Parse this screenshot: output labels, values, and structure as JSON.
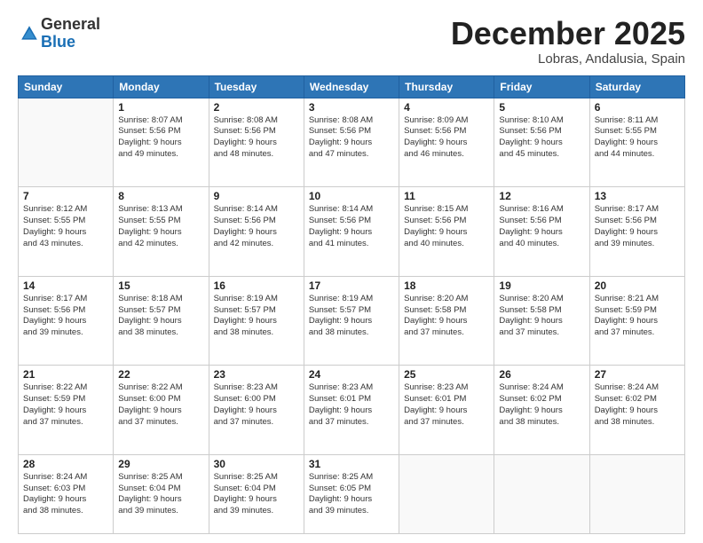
{
  "logo": {
    "general": "General",
    "blue": "Blue"
  },
  "header": {
    "month": "December 2025",
    "location": "Lobras, Andalusia, Spain"
  },
  "weekdays": [
    "Sunday",
    "Monday",
    "Tuesday",
    "Wednesday",
    "Thursday",
    "Friday",
    "Saturday"
  ],
  "weeks": [
    [
      {
        "day": "",
        "lines": []
      },
      {
        "day": "1",
        "lines": [
          "Sunrise: 8:07 AM",
          "Sunset: 5:56 PM",
          "Daylight: 9 hours",
          "and 49 minutes."
        ]
      },
      {
        "day": "2",
        "lines": [
          "Sunrise: 8:08 AM",
          "Sunset: 5:56 PM",
          "Daylight: 9 hours",
          "and 48 minutes."
        ]
      },
      {
        "day": "3",
        "lines": [
          "Sunrise: 8:08 AM",
          "Sunset: 5:56 PM",
          "Daylight: 9 hours",
          "and 47 minutes."
        ]
      },
      {
        "day": "4",
        "lines": [
          "Sunrise: 8:09 AM",
          "Sunset: 5:56 PM",
          "Daylight: 9 hours",
          "and 46 minutes."
        ]
      },
      {
        "day": "5",
        "lines": [
          "Sunrise: 8:10 AM",
          "Sunset: 5:56 PM",
          "Daylight: 9 hours",
          "and 45 minutes."
        ]
      },
      {
        "day": "6",
        "lines": [
          "Sunrise: 8:11 AM",
          "Sunset: 5:55 PM",
          "Daylight: 9 hours",
          "and 44 minutes."
        ]
      }
    ],
    [
      {
        "day": "7",
        "lines": [
          "Sunrise: 8:12 AM",
          "Sunset: 5:55 PM",
          "Daylight: 9 hours",
          "and 43 minutes."
        ]
      },
      {
        "day": "8",
        "lines": [
          "Sunrise: 8:13 AM",
          "Sunset: 5:55 PM",
          "Daylight: 9 hours",
          "and 42 minutes."
        ]
      },
      {
        "day": "9",
        "lines": [
          "Sunrise: 8:14 AM",
          "Sunset: 5:56 PM",
          "Daylight: 9 hours",
          "and 42 minutes."
        ]
      },
      {
        "day": "10",
        "lines": [
          "Sunrise: 8:14 AM",
          "Sunset: 5:56 PM",
          "Daylight: 9 hours",
          "and 41 minutes."
        ]
      },
      {
        "day": "11",
        "lines": [
          "Sunrise: 8:15 AM",
          "Sunset: 5:56 PM",
          "Daylight: 9 hours",
          "and 40 minutes."
        ]
      },
      {
        "day": "12",
        "lines": [
          "Sunrise: 8:16 AM",
          "Sunset: 5:56 PM",
          "Daylight: 9 hours",
          "and 40 minutes."
        ]
      },
      {
        "day": "13",
        "lines": [
          "Sunrise: 8:17 AM",
          "Sunset: 5:56 PM",
          "Daylight: 9 hours",
          "and 39 minutes."
        ]
      }
    ],
    [
      {
        "day": "14",
        "lines": [
          "Sunrise: 8:17 AM",
          "Sunset: 5:56 PM",
          "Daylight: 9 hours",
          "and 39 minutes."
        ]
      },
      {
        "day": "15",
        "lines": [
          "Sunrise: 8:18 AM",
          "Sunset: 5:57 PM",
          "Daylight: 9 hours",
          "and 38 minutes."
        ]
      },
      {
        "day": "16",
        "lines": [
          "Sunrise: 8:19 AM",
          "Sunset: 5:57 PM",
          "Daylight: 9 hours",
          "and 38 minutes."
        ]
      },
      {
        "day": "17",
        "lines": [
          "Sunrise: 8:19 AM",
          "Sunset: 5:57 PM",
          "Daylight: 9 hours",
          "and 38 minutes."
        ]
      },
      {
        "day": "18",
        "lines": [
          "Sunrise: 8:20 AM",
          "Sunset: 5:58 PM",
          "Daylight: 9 hours",
          "and 37 minutes."
        ]
      },
      {
        "day": "19",
        "lines": [
          "Sunrise: 8:20 AM",
          "Sunset: 5:58 PM",
          "Daylight: 9 hours",
          "and 37 minutes."
        ]
      },
      {
        "day": "20",
        "lines": [
          "Sunrise: 8:21 AM",
          "Sunset: 5:59 PM",
          "Daylight: 9 hours",
          "and 37 minutes."
        ]
      }
    ],
    [
      {
        "day": "21",
        "lines": [
          "Sunrise: 8:22 AM",
          "Sunset: 5:59 PM",
          "Daylight: 9 hours",
          "and 37 minutes."
        ]
      },
      {
        "day": "22",
        "lines": [
          "Sunrise: 8:22 AM",
          "Sunset: 6:00 PM",
          "Daylight: 9 hours",
          "and 37 minutes."
        ]
      },
      {
        "day": "23",
        "lines": [
          "Sunrise: 8:23 AM",
          "Sunset: 6:00 PM",
          "Daylight: 9 hours",
          "and 37 minutes."
        ]
      },
      {
        "day": "24",
        "lines": [
          "Sunrise: 8:23 AM",
          "Sunset: 6:01 PM",
          "Daylight: 9 hours",
          "and 37 minutes."
        ]
      },
      {
        "day": "25",
        "lines": [
          "Sunrise: 8:23 AM",
          "Sunset: 6:01 PM",
          "Daylight: 9 hours",
          "and 37 minutes."
        ]
      },
      {
        "day": "26",
        "lines": [
          "Sunrise: 8:24 AM",
          "Sunset: 6:02 PM",
          "Daylight: 9 hours",
          "and 38 minutes."
        ]
      },
      {
        "day": "27",
        "lines": [
          "Sunrise: 8:24 AM",
          "Sunset: 6:02 PM",
          "Daylight: 9 hours",
          "and 38 minutes."
        ]
      }
    ],
    [
      {
        "day": "28",
        "lines": [
          "Sunrise: 8:24 AM",
          "Sunset: 6:03 PM",
          "Daylight: 9 hours",
          "and 38 minutes."
        ]
      },
      {
        "day": "29",
        "lines": [
          "Sunrise: 8:25 AM",
          "Sunset: 6:04 PM",
          "Daylight: 9 hours",
          "and 39 minutes."
        ]
      },
      {
        "day": "30",
        "lines": [
          "Sunrise: 8:25 AM",
          "Sunset: 6:04 PM",
          "Daylight: 9 hours",
          "and 39 minutes."
        ]
      },
      {
        "day": "31",
        "lines": [
          "Sunrise: 8:25 AM",
          "Sunset: 6:05 PM",
          "Daylight: 9 hours",
          "and 39 minutes."
        ]
      },
      {
        "day": "",
        "lines": []
      },
      {
        "day": "",
        "lines": []
      },
      {
        "day": "",
        "lines": []
      }
    ]
  ]
}
